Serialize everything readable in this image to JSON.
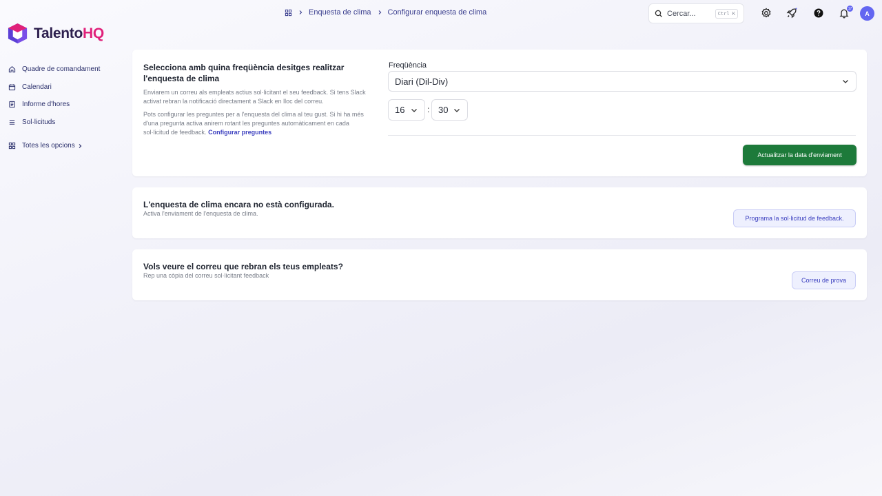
{
  "brand": {
    "name_part1": "Talento",
    "name_part2": "HQ"
  },
  "sidebar": {
    "items": [
      {
        "label": "Quadre de comandament",
        "icon": "home-icon"
      },
      {
        "label": "Calendari",
        "icon": "calendar-icon"
      },
      {
        "label": "Informe d'hores",
        "icon": "report-icon"
      },
      {
        "label": "Sol·licituds",
        "icon": "list-icon"
      }
    ],
    "all_options": "Totes les opcions"
  },
  "breadcrumb": {
    "items": [
      "Enquesta de clima",
      "Configurar enquesta de clima"
    ]
  },
  "search": {
    "placeholder": "Cercar...",
    "shortcut": "Ctrl K"
  },
  "notifications": {
    "count": "17"
  },
  "user": {
    "initial": "A"
  },
  "frequency_card": {
    "title": "Selecciona amb quina freqüència desitges realitzar l'enquesta de clima",
    "description1": "Enviarem un correu als empleats actius sol·licitant el seu feedback. Si tens Slack activat rebran la notificació directament a Slack en lloc del correu.",
    "description2": "Pots configurar les preguntes per a l'enquesta del clima al teu gust. Si hi ha més d'una pregunta activa anirem rotant les preguntes automàticament en cada sol·licitud de feedback.",
    "link": "Configurar preguntes",
    "frequency_label": "Freqüència",
    "frequency_value": "Diari (Dil-Div)",
    "hour": "16",
    "minute": "30",
    "separator": ":",
    "update_button": "Actualitzar la data d'enviament"
  },
  "status_card": {
    "title": "L'enquesta de clima encara no està configurada.",
    "subtitle": "Activa l'enviament de l'enquesta de clima.",
    "button": "Programa la sol·licitud de feedback."
  },
  "email_card": {
    "title": "Vols veure el correu que rebran els teus empleats?",
    "subtitle": "Rep una còpia del correu sol·licitant feedback",
    "button": "Correu de prova"
  },
  "colors": {
    "accent": "#6366f1",
    "primary_button": "#1d7a3a",
    "link": "#3b3fbf",
    "brand_pink": "#e0217a"
  }
}
